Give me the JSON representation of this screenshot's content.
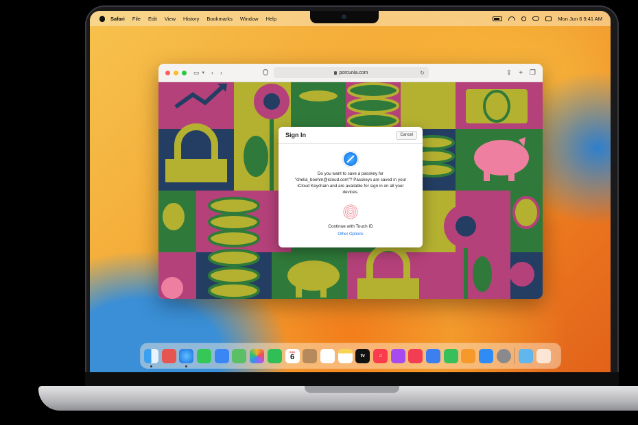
{
  "menubar": {
    "app_name": "Safari",
    "items": [
      "File",
      "Edit",
      "View",
      "History",
      "Bookmarks",
      "Window",
      "Help"
    ],
    "clock": "Mon Jun 6  9:41 AM"
  },
  "safari": {
    "url": "porcunia.com"
  },
  "dialog": {
    "title": "Sign In",
    "cancel_label": "Cancel",
    "message": "Do you want to save a passkey for \"chelia_boehm@icloud.com\"? Passkeys are saved in your iCloud Keychain and are available for sign in on all your devices.",
    "touch_id_label": "Continue with Touch ID",
    "other_options_label": "Other Options"
  },
  "dock": {
    "calendar_day": "6",
    "calendar_month": "JUN",
    "tv_label": "tv"
  },
  "colors": {
    "accent_link": "#1a73e8",
    "art_magenta": "#b5417a",
    "art_olive": "#b4b131",
    "art_navy": "#243d63",
    "art_green": "#2f7a3a",
    "art_pink": "#ef7fa0"
  }
}
